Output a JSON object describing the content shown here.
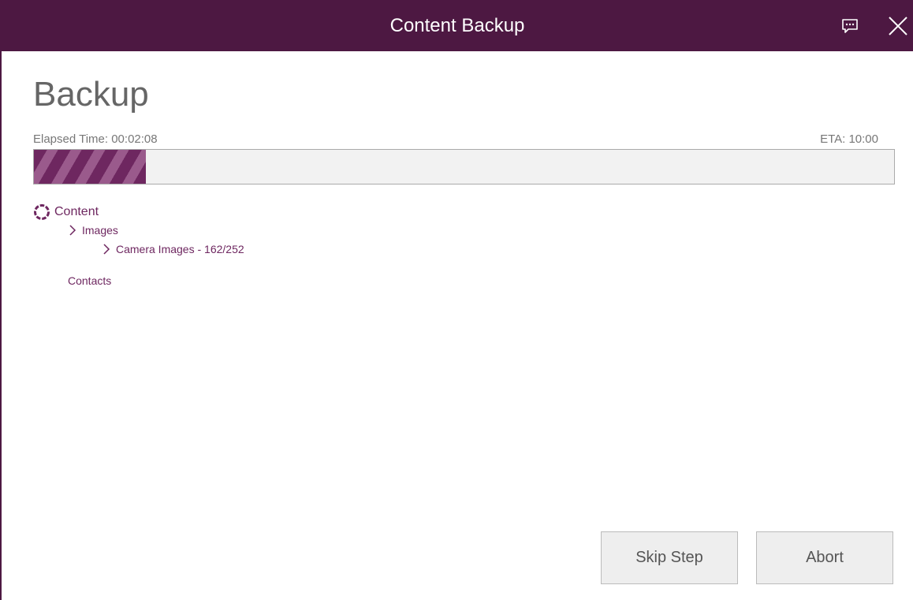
{
  "window": {
    "title": "Content Backup",
    "brand_color": "#4d1842",
    "accent_color": "#6e2760"
  },
  "titlebar_icons": {
    "feedback": "chat-bubble-icon",
    "close": "close-icon"
  },
  "page": {
    "heading": "Backup"
  },
  "progress": {
    "elapsed_label": "Elapsed Time: 00:02:08",
    "eta_label": "ETA: 10:00",
    "fill_fraction": 0.13
  },
  "tree": {
    "content": {
      "label": "Content",
      "icon": "spinner-icon"
    },
    "images": {
      "label": "Images",
      "icon": "chevron-right-icon"
    },
    "camera_images": {
      "label": "Camera Images - 162/252",
      "icon": "chevron-right-icon"
    },
    "contacts": {
      "label": "Contacts"
    }
  },
  "buttons": {
    "skip": "Skip Step",
    "abort": "Abort"
  }
}
